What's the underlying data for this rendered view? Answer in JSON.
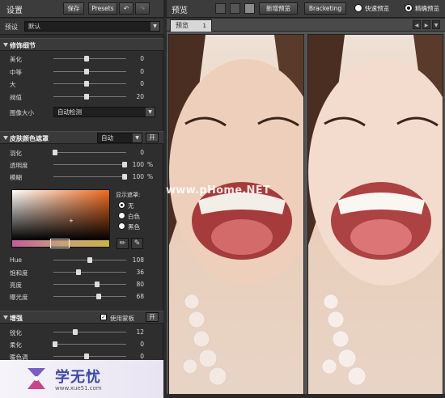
{
  "header": {
    "panel_title": "设置",
    "save_label": "保存",
    "presets_label": "Presets",
    "undo_icon": "undo-icon",
    "redo_icon": "redo-icon",
    "preview_title": "预览",
    "new_preview_label": "新增预览",
    "bracketing_label": "Bracketing",
    "fast_preview_label": "快速预览",
    "accurate_preview_label": "精确预览"
  },
  "preset": {
    "label": "预设",
    "value": "默认"
  },
  "sections": {
    "detail": {
      "title": "修饰细节",
      "sliders": [
        {
          "label": "美化",
          "value": "0",
          "pos": 0.45
        },
        {
          "label": "中等",
          "value": "0",
          "pos": 0.45
        },
        {
          "label": "大",
          "value": "0",
          "pos": 0.45
        },
        {
          "label": "阀值",
          "value": "20",
          "pos": 0.45
        }
      ],
      "image_size_label": "图像大小",
      "image_size_value": "自动检测"
    },
    "skin": {
      "title": "皮肤颜色遮罩",
      "mode_value": "自动",
      "open_label": "开",
      "sliders": [
        {
          "label": "羽化",
          "value": "0",
          "unit": "",
          "pos": 0.02
        },
        {
          "label": "透明度",
          "value": "100",
          "unit": "%",
          "pos": 0.98
        },
        {
          "label": "模糊",
          "value": "100",
          "unit": "%",
          "pos": 0.98
        }
      ],
      "mask_label": "显示遮罩:",
      "mask_options": [
        "无",
        "白色",
        "黑色"
      ],
      "mask_selected": 0,
      "color_sliders": [
        {
          "label": "Hue",
          "value": "108",
          "pos": 0.5
        },
        {
          "label": "饱和度",
          "value": "36",
          "pos": 0.34
        },
        {
          "label": "亮度",
          "value": "80",
          "pos": 0.6
        },
        {
          "label": "曝光度",
          "value": "68",
          "pos": 0.62
        }
      ]
    },
    "enhance": {
      "title": "增强",
      "use_mask_label": "使用蒙板",
      "open_label": "开",
      "sliders": [
        {
          "label": "锐化",
          "value": "12",
          "pos": 0.3
        },
        {
          "label": "柔化",
          "value": "0",
          "pos": 0.02
        },
        {
          "label": "暖色调",
          "value": "0",
          "pos": 0.45
        }
      ]
    }
  },
  "preview": {
    "tab_label": "预览",
    "tab_close": "1",
    "watermark": "www.pHome.NET"
  },
  "branding": {
    "site_name": "学无忧",
    "site_url": "www.xue51.com"
  }
}
